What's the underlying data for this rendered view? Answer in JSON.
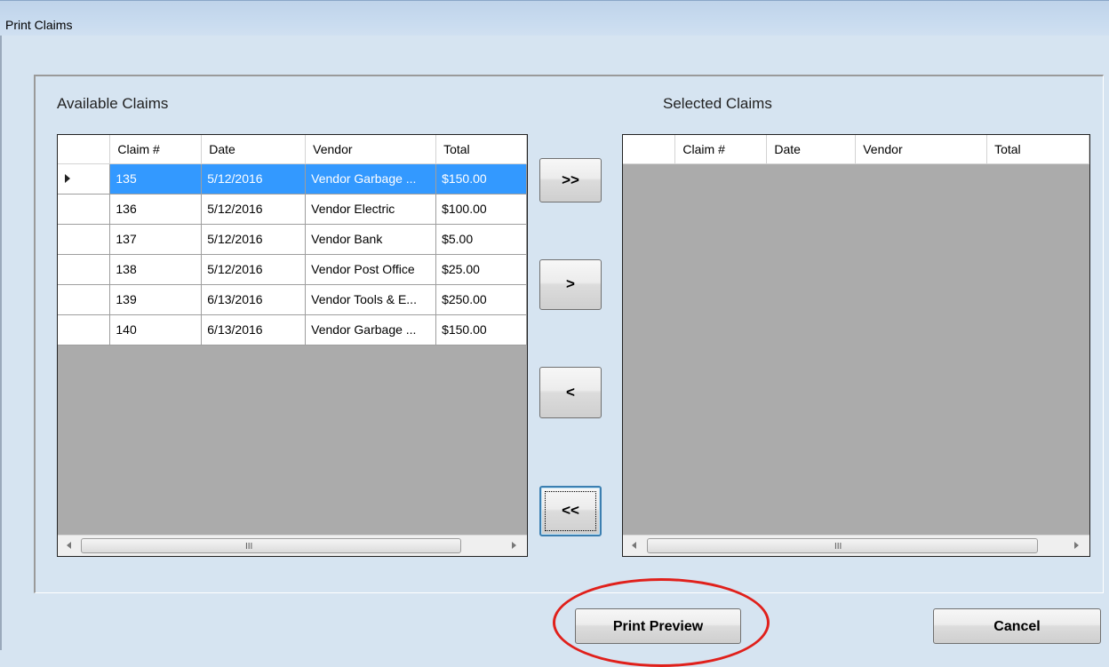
{
  "window": {
    "title": "Print Claims"
  },
  "available": {
    "label": "Available Claims",
    "columns": [
      "Claim #",
      "Date",
      "Vendor",
      "Total"
    ],
    "rows": [
      {
        "claim": "135",
        "date": "5/12/2016",
        "vendor": "Vendor Garbage ...",
        "total": "$150.00",
        "selected": true
      },
      {
        "claim": "136",
        "date": "5/12/2016",
        "vendor": "Vendor Electric",
        "total": "$100.00"
      },
      {
        "claim": "137",
        "date": "5/12/2016",
        "vendor": "Vendor Bank",
        "total": "$5.00"
      },
      {
        "claim": "138",
        "date": "5/12/2016",
        "vendor": "Vendor Post Office",
        "total": "$25.00"
      },
      {
        "claim": "139",
        "date": "6/13/2016",
        "vendor": "Vendor Tools & E...",
        "total": "$250.00"
      },
      {
        "claim": "140",
        "date": "6/13/2016",
        "vendor": "Vendor Garbage ...",
        "total": "$150.00"
      }
    ],
    "scroll_grip": "III"
  },
  "selected": {
    "label": "Selected Claims",
    "columns": [
      "Claim #",
      "Date",
      "Vendor",
      "Total"
    ],
    "scroll_grip": "III"
  },
  "buttons": {
    "add_all": ">>",
    "add_one": ">",
    "remove_one": "<",
    "remove_all": "<<",
    "print_preview": "Print Preview",
    "cancel": "Cancel"
  },
  "colors": {
    "selection": "#3399ff",
    "annotation": "#e0201b"
  }
}
